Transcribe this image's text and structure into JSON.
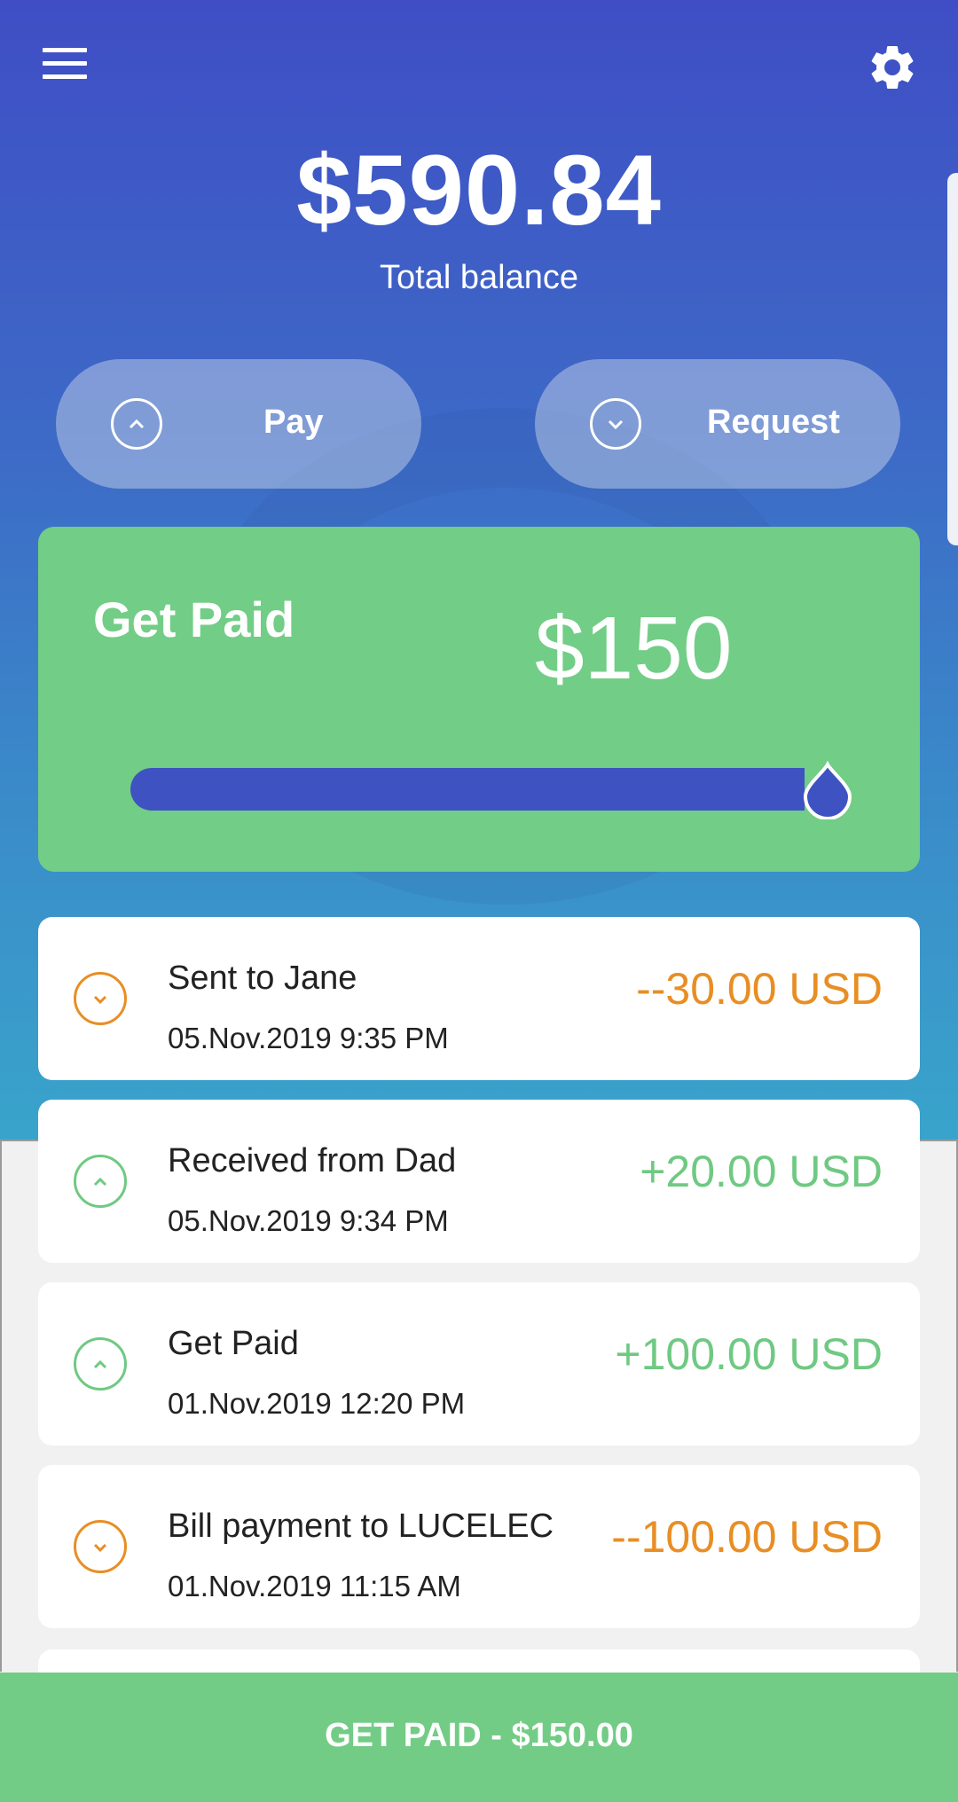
{
  "header": {
    "menu_icon": "hamburger-menu-icon",
    "settings_icon": "gear-icon"
  },
  "balance": {
    "amount": "$590.84",
    "label": "Total balance"
  },
  "actions": {
    "pay_label": "Pay",
    "pay_icon": "chevron-up-circle-icon",
    "request_label": "Request",
    "request_icon": "chevron-down-circle-icon"
  },
  "get_paid_card": {
    "title": "Get Paid",
    "amount": "$150",
    "slider_fill_fraction": 0.95,
    "colors": {
      "card": "#72cd86",
      "track": "#3f52c2"
    }
  },
  "transactions": [
    {
      "title": "Sent to Jane",
      "date": "05.Nov.2019 9:35 PM",
      "amount": "--30.00 USD",
      "direction": "out",
      "color": "#e88e24"
    },
    {
      "title": "Received from Dad",
      "date": "05.Nov.2019 9:34 PM",
      "amount": "+20.00 USD",
      "direction": "in",
      "color": "#6fc982"
    },
    {
      "title": "Get Paid",
      "date": "01.Nov.2019 12:20 PM",
      "amount": "+100.00 USD",
      "direction": "in",
      "color": "#6fc982"
    },
    {
      "title": "Bill payment to LUCELEC",
      "date": "01.Nov.2019 11:15 AM",
      "amount": "--100.00 USD",
      "direction": "out",
      "color": "#e88e24"
    }
  ],
  "bottom_button": {
    "label": "GET PAID - $150.00"
  }
}
